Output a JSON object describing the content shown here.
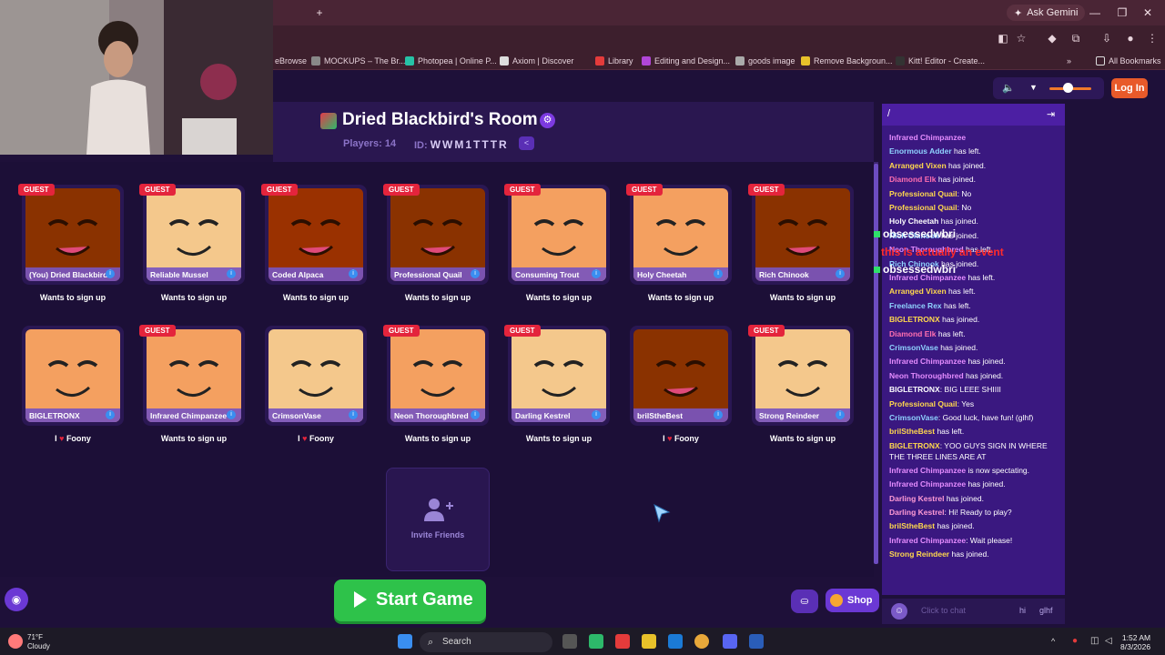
{
  "browser": {
    "gemini_label": "Ask Gemini",
    "bookmarks": [
      "eBrowse",
      "MOCKUPS – The Br...",
      "Photopea | Online P...",
      "Axiom | Discover",
      "Library",
      "Editing and Design...",
      "goods image",
      "Remove Backgroun...",
      "Kitt! Editor - Create..."
    ],
    "all_bookmarks": "All Bookmarks"
  },
  "room": {
    "title": "Dried Blackbird's Room",
    "players_label": "Players: 14",
    "id_prefix": "ID:",
    "id_value": "WWM1TTTR",
    "login_label": "Log In"
  },
  "players": [
    {
      "name": "(You) Dried Blackbird",
      "guest": true,
      "status": "Wants to sign up",
      "heart": false
    },
    {
      "name": "Reliable Mussel",
      "guest": true,
      "status": "Wants to sign up",
      "heart": false
    },
    {
      "name": "Coded Alpaca",
      "guest": true,
      "status": "Wants to sign up",
      "heart": false
    },
    {
      "name": "Professional Quail",
      "guest": true,
      "status": "Wants to sign up",
      "heart": false
    },
    {
      "name": "Consuming Trout",
      "guest": true,
      "status": "Wants to sign up",
      "heart": false
    },
    {
      "name": "Holy Cheetah",
      "guest": true,
      "status": "Wants to sign up",
      "heart": false
    },
    {
      "name": "Rich Chinook",
      "guest": true,
      "status": "Wants to sign up",
      "heart": false
    },
    {
      "name": "BIGLETRONX",
      "guest": false,
      "status": "Foony",
      "heart": true
    },
    {
      "name": "Infrared Chimpanzee",
      "guest": true,
      "status": "Wants to sign up",
      "heart": false
    },
    {
      "name": "CrimsonVase",
      "guest": false,
      "status": "Foony",
      "heart": true
    },
    {
      "name": "Neon Thoroughbred",
      "guest": true,
      "status": "Wants to sign up",
      "heart": false
    },
    {
      "name": "Darling Kestrel",
      "guest": true,
      "status": "Wants to sign up",
      "heart": false
    },
    {
      "name": "brilStheBest",
      "guest": false,
      "status": "Foony",
      "heart": true
    },
    {
      "name": "Strong Reindeer",
      "guest": true,
      "status": "Wants to sign up",
      "heart": false
    }
  ],
  "guest_badge": "GUEST",
  "heart_prefix": "I",
  "invite_label": "Invite Friends",
  "start_label": "Start Game",
  "shop_label": "Shop",
  "chat": {
    "slash": "/",
    "messages": [
      {
        "name": "Infrared Chimpanzee",
        "color": "#e58cff",
        "text": ""
      },
      {
        "name": "Enormous Adder",
        "color": "#8fd3ff",
        "text": " has left."
      },
      {
        "name": "Arranged Vixen",
        "color": "#ffd84d",
        "text": " has joined."
      },
      {
        "name": "Diamond Elk",
        "color": "#ff6fb0",
        "text": " has joined."
      },
      {
        "name": "Professional Quail",
        "color": "#ffd84d",
        "text": ": No"
      },
      {
        "name": "Professional Quail",
        "color": "#ffd84d",
        "text": ": No"
      },
      {
        "name": "Holy Cheetah",
        "color": "#ffffff",
        "text": " has joined."
      },
      {
        "name": "Rich Chinook",
        "color": "#8fd3ff",
        "text": " has joined."
      },
      {
        "name": "Neon Thoroughbred",
        "color": "#e58cff",
        "text": " has left."
      },
      {
        "name": "Rich Chinook",
        "color": "#8fd3ff",
        "text": " has joined."
      },
      {
        "name": "Infrared Chimpanzee",
        "color": "#e58cff",
        "text": " has left."
      },
      {
        "name": "Arranged Vixen",
        "color": "#ffd84d",
        "text": " has left."
      },
      {
        "name": "Freelance Rex",
        "color": "#8fd3ff",
        "text": " has left."
      },
      {
        "name": "BIGLETRONX",
        "color": "#ffd84d",
        "text": " has joined."
      },
      {
        "name": "Diamond Elk",
        "color": "#ff6fb0",
        "text": " has left."
      },
      {
        "name": "CrimsonVase",
        "color": "#8fd3ff",
        "text": " has joined."
      },
      {
        "name": "Infrared Chimpanzee",
        "color": "#e58cff",
        "text": " has joined."
      },
      {
        "name": "Neon Thoroughbred",
        "color": "#e58cff",
        "text": " has joined."
      },
      {
        "name": "BIGLETRONX",
        "color": "#ffffff",
        "text": ": BIG LEEE SHIIII"
      },
      {
        "name": "Professional Quail",
        "color": "#ffd84d",
        "text": ": Yes"
      },
      {
        "name": "CrimsonVase",
        "color": "#8fd3ff",
        "text": ": Good luck, have fun! (glhf)"
      },
      {
        "name": "brilStheBest",
        "color": "#ffd84d",
        "text": " has left."
      },
      {
        "name": "BIGLETRONX",
        "color": "#ffd84d",
        "text": ": YOO GUYS SIGN IN WHERE THE THREE LINES ARE AT"
      },
      {
        "name": "Infrared Chimpanzee",
        "color": "#e58cff",
        "text": " is now spectating."
      },
      {
        "name": "Infrared Chimpanzee",
        "color": "#e58cff",
        "text": " has joined."
      },
      {
        "name": "Darling Kestrel",
        "color": "#ff9bd5",
        "text": " has joined."
      },
      {
        "name": "Darling Kestrel",
        "color": "#ff9bd5",
        "text": ": Hi! Ready to play?"
      },
      {
        "name": "brilStheBest",
        "color": "#ffd84d",
        "text": " has joined."
      },
      {
        "name": "Infrared Chimpanzee",
        "color": "#e58cff",
        "text": ": Wait please!"
      },
      {
        "name": "Strong Reindeer",
        "color": "#ffd84d",
        "text": " has joined."
      }
    ],
    "input_placeholder": "Click to chat",
    "quick_hi": "hi",
    "quick_glhf": "glhf"
  },
  "twitch_overlay": [
    {
      "user": "obsessedwbri",
      "msg": ""
    },
    {
      "user": "",
      "msg": "this is actually an event"
    },
    {
      "user": "obsessedwbri",
      "msg": ""
    }
  ],
  "taskbar": {
    "weather_temp": "71°F",
    "weather_desc": "Cloudy",
    "search_label": "Search",
    "time": "1:52 AM",
    "date": "8/3/2026"
  }
}
